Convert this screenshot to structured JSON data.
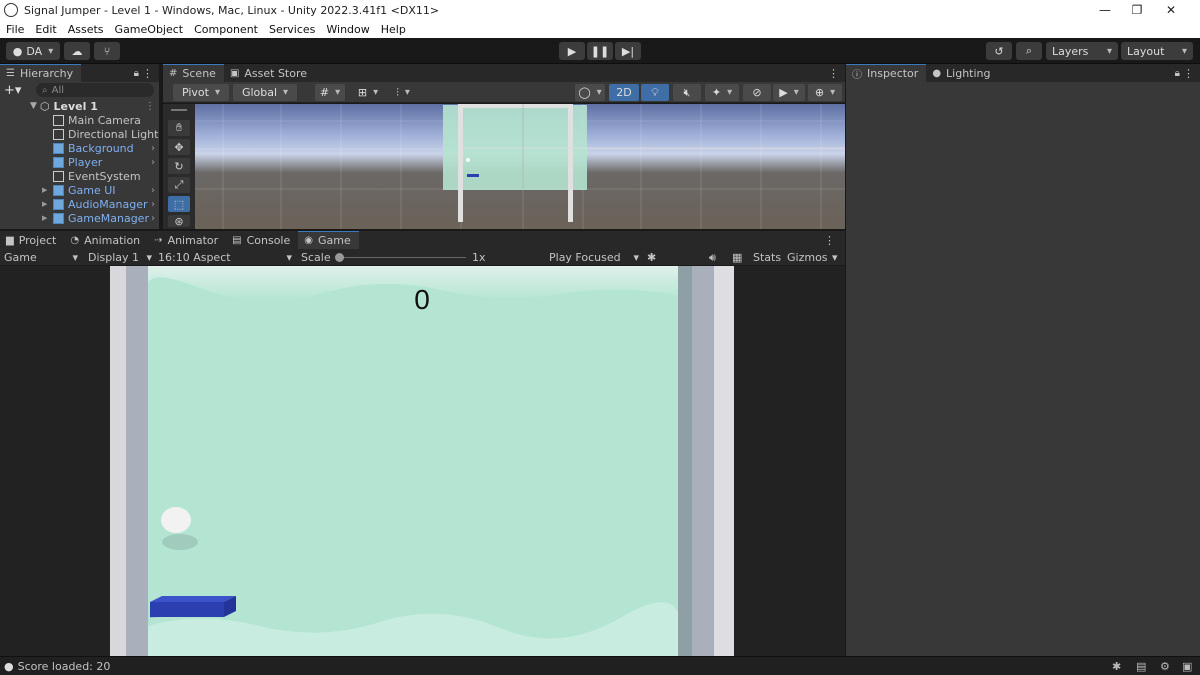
{
  "window": {
    "title": "Signal Jumper - Level 1 - Windows, Mac, Linux - Unity 2022.3.41f1 <DX11>",
    "minimize": "—",
    "maximize": "❐",
    "close": "✕"
  },
  "menu": [
    "File",
    "Edit",
    "Assets",
    "GameObject",
    "Component",
    "Services",
    "Window",
    "Help"
  ],
  "toolbar": {
    "account": "DA",
    "layers": "Layers",
    "layout": "Layout"
  },
  "hierarchy": {
    "tab": "Hierarchy",
    "search_placeholder": "All",
    "scene": "Level 1",
    "items": [
      {
        "label": "Main Camera",
        "prefab": false,
        "has_arrow": false,
        "expandable": false
      },
      {
        "label": "Directional Light",
        "prefab": false,
        "has_arrow": false,
        "expandable": false
      },
      {
        "label": "Background",
        "prefab": true,
        "has_arrow": true,
        "expandable": false
      },
      {
        "label": "Player",
        "prefab": true,
        "has_arrow": true,
        "expandable": false
      },
      {
        "label": "EventSystem",
        "prefab": false,
        "has_arrow": false,
        "expandable": false
      },
      {
        "label": "Game UI",
        "prefab": true,
        "has_arrow": true,
        "expandable": true
      },
      {
        "label": "AudioManager",
        "prefab": true,
        "has_arrow": true,
        "expandable": true
      },
      {
        "label": "GameManager",
        "prefab": true,
        "has_arrow": true,
        "expandable": true
      }
    ]
  },
  "scene_tabs": {
    "scene": "Scene",
    "asset_store": "Asset Store"
  },
  "scene_toolbar": {
    "pivot": "Pivot",
    "global": "Global",
    "mode_2d": "2D"
  },
  "bottom_tabs": [
    "Project",
    "Animation",
    "Animator",
    "Console",
    "Game"
  ],
  "game_toolbar": {
    "mode": "Game",
    "display": "Display 1",
    "aspect": "16:10 Aspect",
    "scale_label": "Scale",
    "scale_value": "1x",
    "play_focused": "Play Focused",
    "stats": "Stats",
    "gizmos": "Gizmos"
  },
  "game": {
    "score": "0"
  },
  "inspector_tabs": {
    "inspector": "Inspector",
    "lighting": "Lighting"
  },
  "status": {
    "message": "Score loaded: 20"
  },
  "colors": {
    "accent": "#3a79bb",
    "game_bg": "#b3e5d2",
    "platform": "#2b3fb0",
    "wall": "#d4d4d8"
  }
}
